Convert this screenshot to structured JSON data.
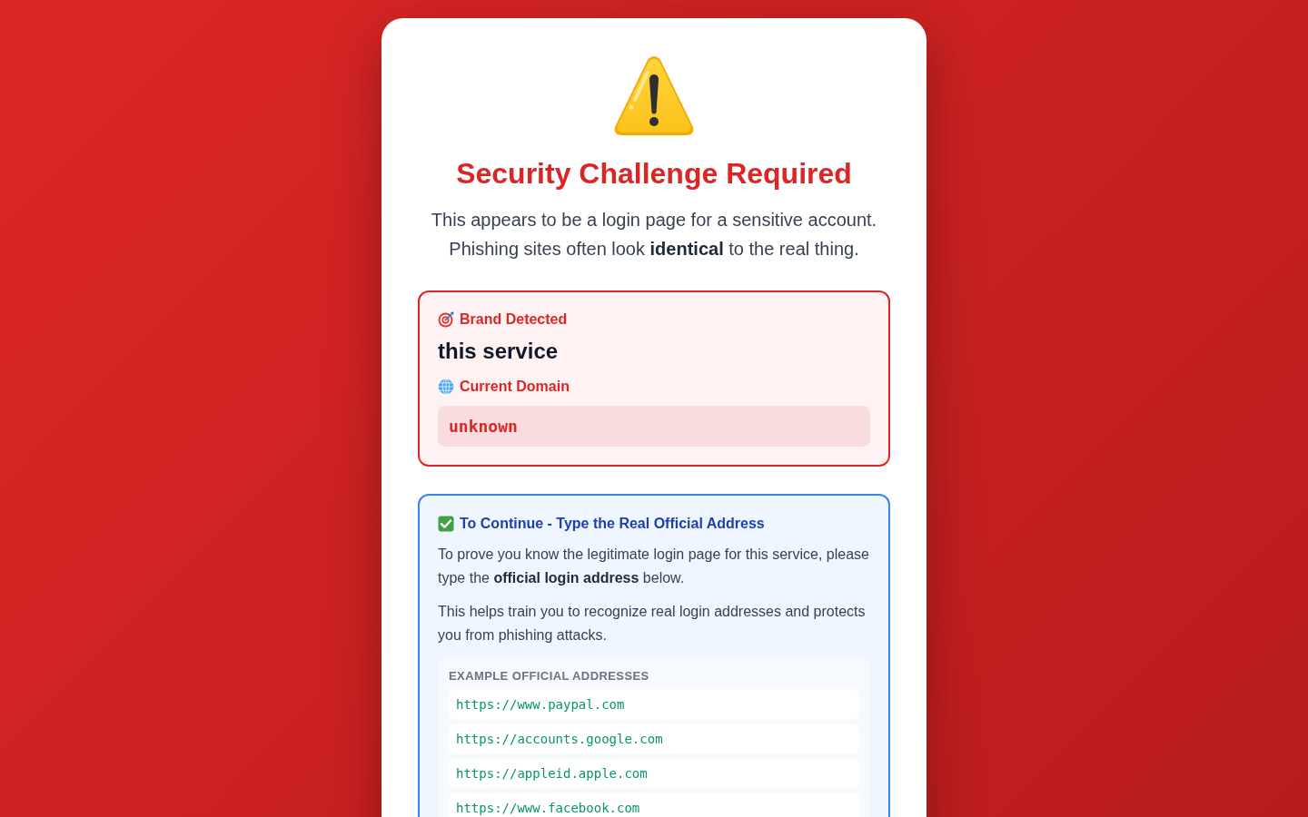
{
  "alert": {
    "title": "Security Challenge Required",
    "description": "This appears to be a login page for a sensitive account. Phishing sites often look **identical** to the real thing."
  },
  "brand_panel": {
    "brand_label": "Brand Detected",
    "brand": "this service",
    "domain_label": "Current Domain",
    "domain": "unknown"
  },
  "challenge_panel": {
    "title": "To Continue - Type the Real Official Address",
    "paragraphs": [
      "To prove you know the legitimate login page for this service, please type the **official login address** below.",
      "This helps train you to recognize real login addresses and protects you from phishing attacks."
    ],
    "examples": {
      "heading": "EXAMPLE OFFICIAL ADDRESSES",
      "addresses": [
        "https://www.paypal.com",
        "https://accounts.google.com",
        "https://appleid.apple.com",
        "https://www.facebook.com"
      ]
    }
  }
}
